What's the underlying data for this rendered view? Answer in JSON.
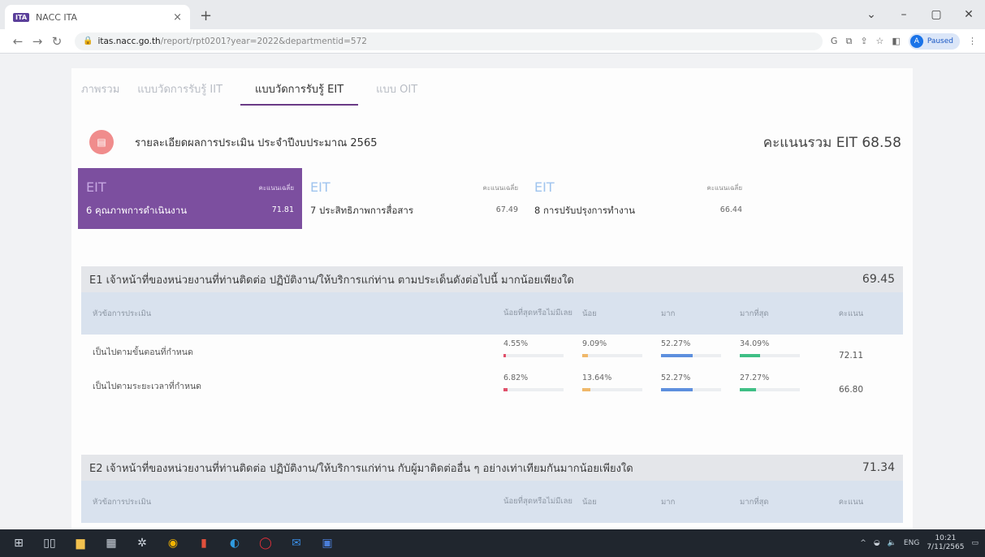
{
  "browser": {
    "tab_title": "NACC ITA",
    "tab_favicon": "ITA",
    "close_tab": "×",
    "new_tab": "+",
    "url_host": "itas.nacc.go.th",
    "url_path": "/report/rpt0201?year=2022&departmentid=572",
    "profile_initial": "A",
    "profile_status": "Paused"
  },
  "subtabs": [
    {
      "label": "ภาพรวม"
    },
    {
      "label": "แบบวัดการรับรู้ IIT"
    },
    {
      "label": "แบบวัดการรับรู้ EIT"
    },
    {
      "label": "แบบ OIT"
    }
  ],
  "report": {
    "title": "รายละเอียดผลการประเมิน ประจำปีงบประมาณ 2565",
    "total_label": "คะแนนรวม EIT 68.58"
  },
  "eit_items": [
    {
      "tag": "EIT",
      "avg_label": "คะแนนเฉลี่ย",
      "name": "6 คุณภาพการดำเนินงาน",
      "score": "71.81"
    },
    {
      "tag": "EIT",
      "avg_label": "คะแนนเฉลี่ย",
      "name": "7 ประสิทธิภาพการสื่อสาร",
      "score": "67.49"
    },
    {
      "tag": "EIT",
      "avg_label": "คะแนนเฉลี่ย",
      "name": "8 การปรับปรุงการทำงาน",
      "score": "66.44"
    }
  ],
  "columns": {
    "topic": "หัวข้อการประเมิน",
    "lowest": "น้อยที่สุดหรือไม่มีเลย",
    "low": "น้อย",
    "high": "มาก",
    "highest": "มากที่สุด",
    "score": "คะแนน"
  },
  "questions": [
    {
      "title": "E1 เจ้าหน้าที่ของหน่วยงานที่ท่านติดต่อ ปฏิบัติงาน/ให้บริการแก่ท่าน ตามประเด็นดังต่อไปนี้ มากน้อยเพียงใด",
      "score": "69.45",
      "rows": [
        {
          "topic": "เป็นไปตามขั้นตอนที่กำหนด",
          "lowest": "4.55%",
          "low": "9.09%",
          "high": "52.27%",
          "highest": "34.09%",
          "score": "72.11"
        },
        {
          "topic": "เป็นไปตามระยะเวลาที่กำหนด",
          "lowest": "6.82%",
          "low": "13.64%",
          "high": "52.27%",
          "highest": "27.27%",
          "score": "66.80"
        }
      ]
    },
    {
      "title": "E2 เจ้าหน้าที่ของหน่วยงานที่ท่านติดต่อ ปฏิบัติงาน/ให้บริการแก่ท่าน กับผู้มาติดต่ออื่น ๆ อย่างเท่าเทียมกันมากน้อยเพียงใด",
      "score": "71.34",
      "rows": []
    }
  ],
  "bar_colors": {
    "lowest": "#e0506a",
    "low": "#f0b86a",
    "high": "#5d8fde",
    "highest": "#3fbf85"
  },
  "taskbar": {
    "lang": "ENG",
    "time": "10:21",
    "date": "7/11/2565"
  }
}
